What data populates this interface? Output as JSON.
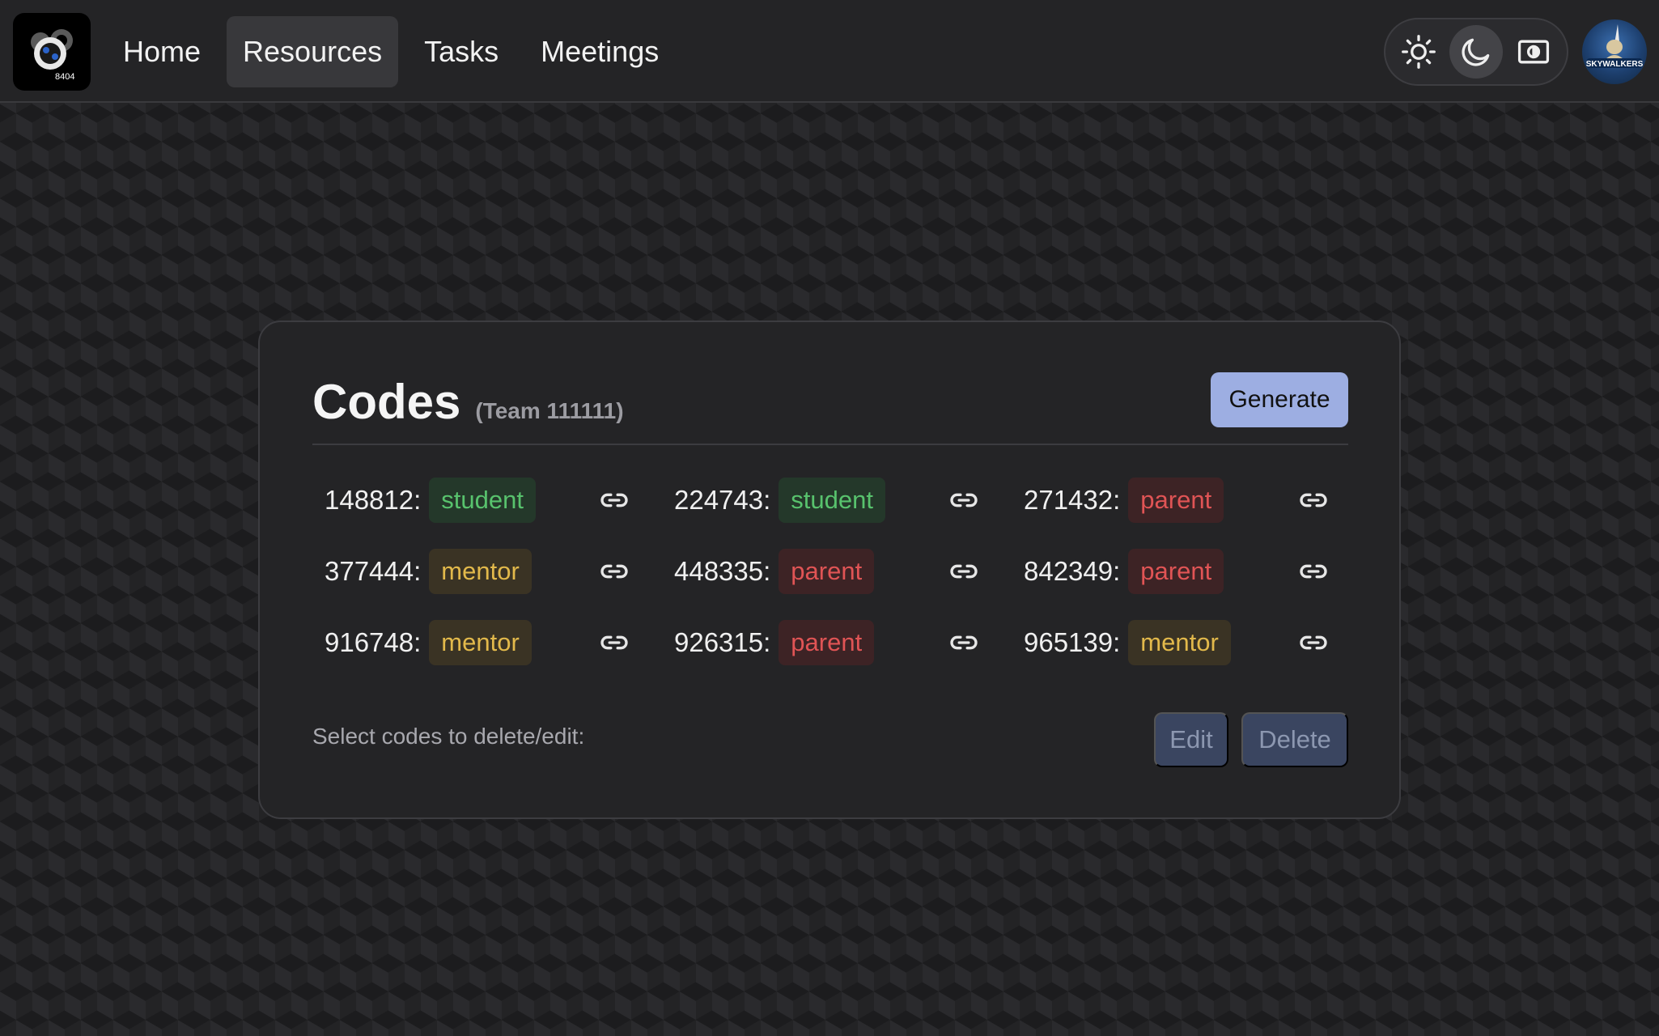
{
  "nav": {
    "links": [
      {
        "label": "Home",
        "active": false
      },
      {
        "label": "Resources",
        "active": true
      },
      {
        "label": "Tasks",
        "active": false
      },
      {
        "label": "Meetings",
        "active": false
      }
    ],
    "logo_icon": "team-gear-logo",
    "theme_options": [
      {
        "icon": "sun-icon",
        "active": false
      },
      {
        "icon": "moon-icon",
        "active": true
      },
      {
        "icon": "contrast-icon",
        "active": false
      }
    ],
    "avatar_icon": "user-avatar"
  },
  "codes_card": {
    "title": "Codes",
    "subtitle": "(Team 111111)",
    "generate_label": "Generate",
    "codes": [
      {
        "code": "148812:",
        "role": "student"
      },
      {
        "code": "224743:",
        "role": "student"
      },
      {
        "code": "271432:",
        "role": "parent"
      },
      {
        "code": "377444:",
        "role": "mentor"
      },
      {
        "code": "448335:",
        "role": "parent"
      },
      {
        "code": "842349:",
        "role": "parent"
      },
      {
        "code": "916748:",
        "role": "mentor"
      },
      {
        "code": "926315:",
        "role": "parent"
      },
      {
        "code": "965139:",
        "role": "mentor"
      }
    ],
    "select_hint": "Select codes to delete/edit:",
    "edit_label": "Edit",
    "delete_label": "Delete"
  },
  "colors": {
    "student": "#58c26d",
    "mentor": "#e2b94b",
    "parent": "#e05455",
    "accent": "#9daee2"
  }
}
